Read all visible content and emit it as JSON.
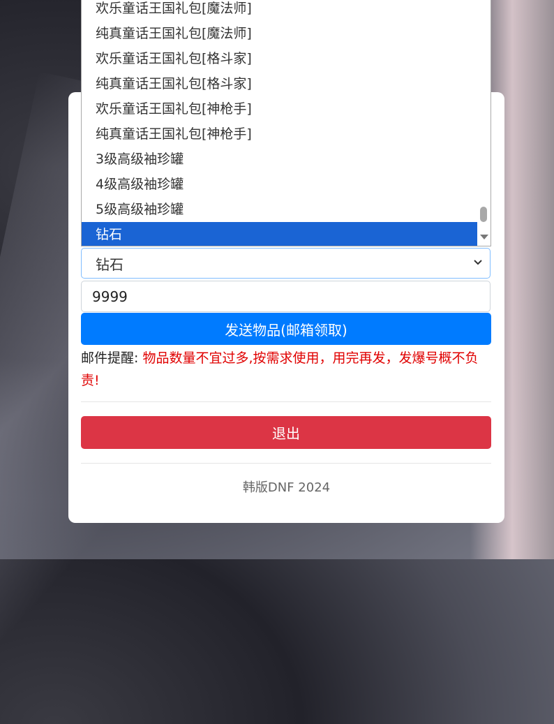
{
  "dropdown": {
    "options": [
      "欢乐童话王国礼包[魔法师]",
      "纯真童话王国礼包[魔法师]",
      "欢乐童话王国礼包[格斗家]",
      "纯真童话王国礼包[格斗家]",
      "欢乐童话王国礼包[神枪手]",
      "纯真童话王国礼包[神枪手]",
      "3级高级袖珍罐",
      "4级高级袖珍罐",
      "5级高级袖珍罐",
      "钻石"
    ],
    "selected_index": 9
  },
  "item_select": {
    "value": "钻石"
  },
  "quantity": {
    "value": "9999"
  },
  "send_button": {
    "label": "发送物品(邮箱领取)"
  },
  "notice": {
    "label": "邮件提醒:",
    "warning": "物品数量不宜过多,按需求使用，用完再发，发爆号概不负责!"
  },
  "logout_button": {
    "label": "退出"
  },
  "footer": {
    "text": "韩版DNF 2024"
  },
  "colors": {
    "primary": "#007bff",
    "danger": "#dc3545",
    "warning_text": "#e00000",
    "selected_option": "#1a64d4"
  }
}
